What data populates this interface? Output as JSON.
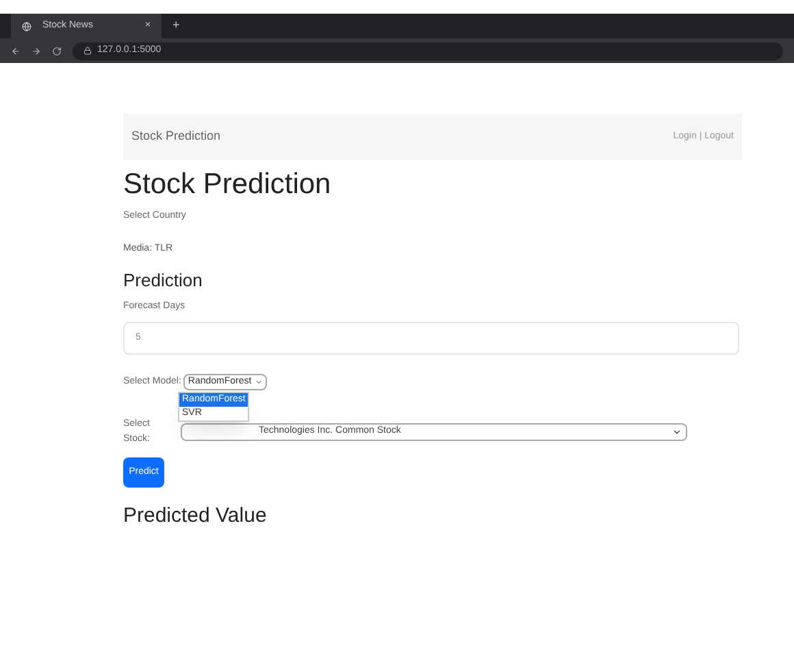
{
  "browser": {
    "tab_title": "Stock News",
    "new_tab": "+",
    "tab_close": "×",
    "address": "127.0.0.1:5000"
  },
  "navbar": {
    "brand": "Stock Prediction",
    "right": "Login | Logout"
  },
  "title": "Stock Prediction",
  "select_country": "Select Country",
  "media": "Media: TLR",
  "prediction_heading": "Prediction",
  "forecast_label": "Forecast Days",
  "forecast_value": "5",
  "model_label": "Select Model:",
  "model_value": "RandomForest",
  "model_options": [
    {
      "label": "RandomForest",
      "selected": true
    },
    {
      "label": "SVR",
      "selected": false
    }
  ],
  "stock_label": "Select Stock:",
  "stock_value": "Technologies Inc. Common Stock",
  "predict_button": "Predict",
  "result_heading": "Predicted Value"
}
